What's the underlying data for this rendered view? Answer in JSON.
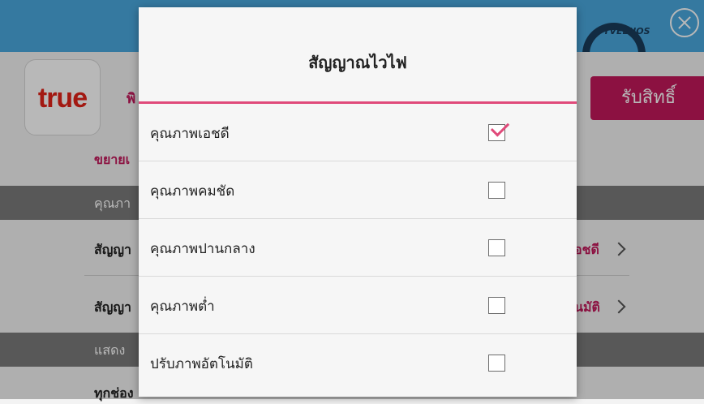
{
  "background": {
    "logo_text": "true",
    "app_sub": "พิ",
    "get_button": "รับสิทธิ์",
    "expand_link": "ขยายเ",
    "section1": "คุณภา",
    "row1_label": "สัญญา",
    "row1_value": "อชดี",
    "row2_label": "สัญญา",
    "row2_value": "นมัติ",
    "section2": "แสดง",
    "row3_label": "ทุกช่อง",
    "banner_text": "TVEENOS"
  },
  "dialog": {
    "title": "สัญญาณไวไฟ",
    "options": [
      {
        "label": "คุณภาพเอชดี",
        "checked": true
      },
      {
        "label": "คุณภาพคมชัด",
        "checked": false
      },
      {
        "label": "คุณภาพปานกลาง",
        "checked": false
      },
      {
        "label": "คุณภาพต่ำ",
        "checked": false
      },
      {
        "label": "ปรับภาพอัตโนมัติ",
        "checked": false
      }
    ]
  },
  "colors": {
    "accent": "#e04a7a",
    "brand": "#c2185b",
    "topbar": "#4aa8de"
  }
}
